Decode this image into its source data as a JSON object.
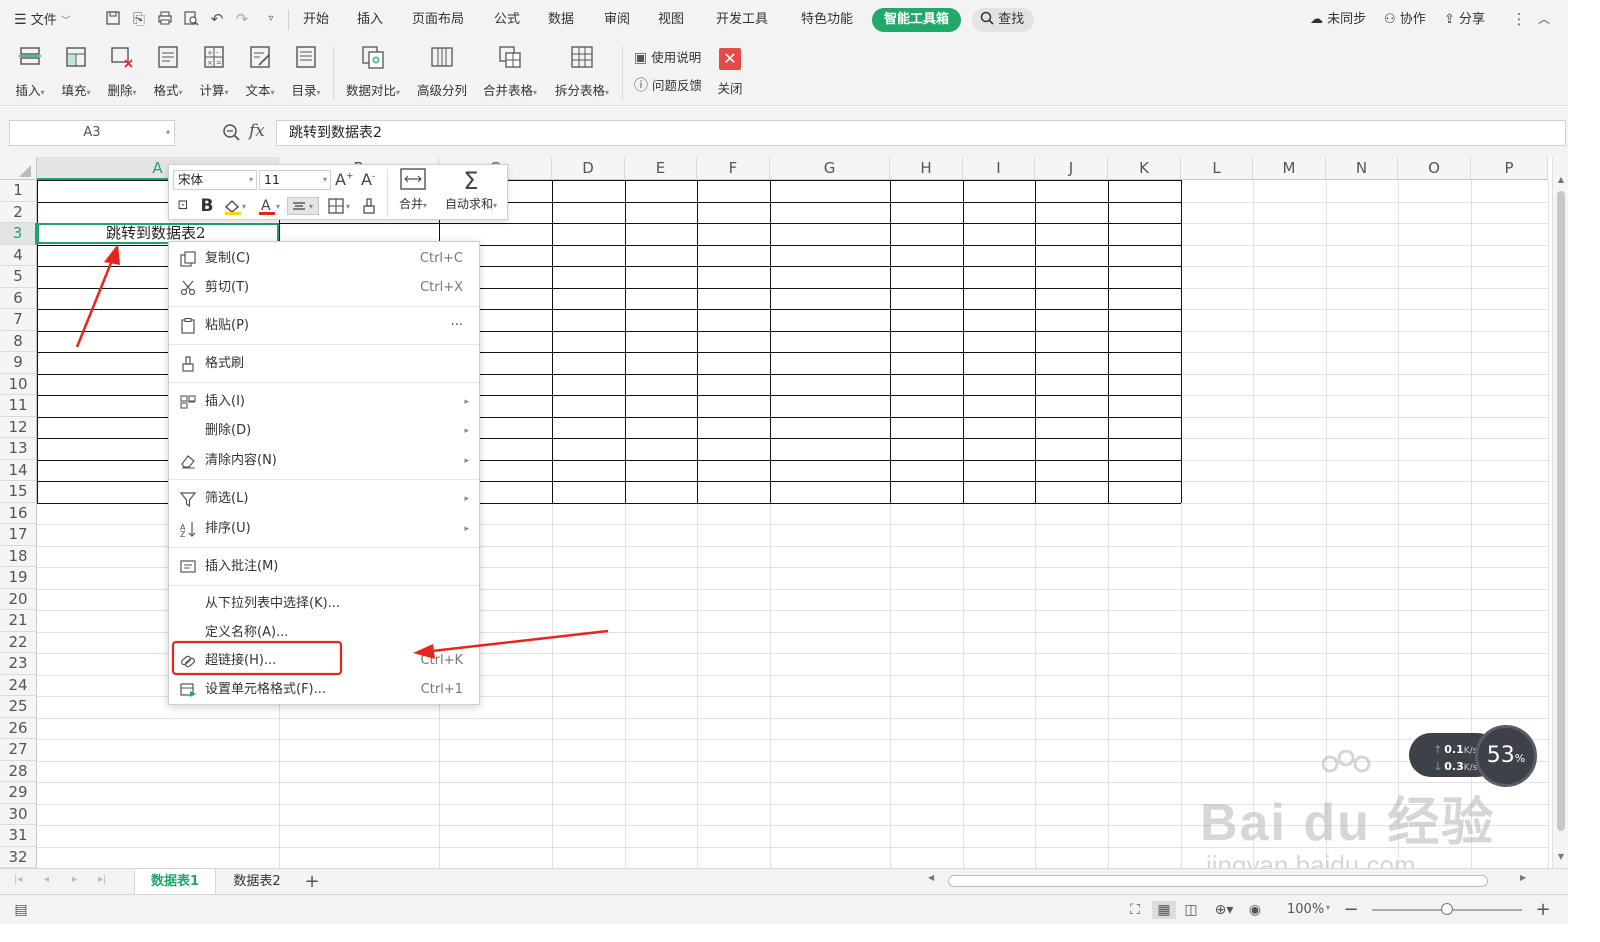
{
  "menubar": {
    "file_label": "文件",
    "tabs": [
      "开始",
      "插入",
      "页面布局",
      "公式",
      "数据",
      "审阅",
      "视图",
      "开发工具",
      "特色功能"
    ],
    "active_tab": "智能工具箱",
    "search_label": "查找",
    "sync_label": "未同步",
    "collab_label": "协作",
    "share_label": "分享"
  },
  "ribbon": {
    "buttons": [
      "插入",
      "填充",
      "删除",
      "格式",
      "计算",
      "文本",
      "目录",
      "数据对比",
      "高级分列",
      "合并表格",
      "拆分表格"
    ],
    "help_label": "使用说明",
    "feedback_label": "问题反馈",
    "close_label": "关闭"
  },
  "formula": {
    "name_box": "A3",
    "fx_label": "fx",
    "content": "跳转到数据表2"
  },
  "grid": {
    "columns": [
      "A",
      "B",
      "C",
      "D",
      "E",
      "F",
      "G",
      "H",
      "I",
      "J",
      "K",
      "L",
      "M",
      "N",
      "O",
      "P"
    ],
    "rows": [
      "1",
      "2",
      "3",
      "4",
      "5",
      "6",
      "7",
      "8",
      "9",
      "10",
      "11",
      "12",
      "13",
      "14",
      "15",
      "16",
      "17",
      "18",
      "19",
      "20",
      "21",
      "22",
      "23",
      "24",
      "25",
      "26",
      "27",
      "28",
      "29",
      "30",
      "31",
      "32"
    ],
    "cell_a3": "跳转到数据表2"
  },
  "minibar": {
    "font": "宋体",
    "size": "11",
    "merge_label": "合并",
    "autosum_label": "自动求和"
  },
  "context_menu": {
    "copy": {
      "label": "复制(C)",
      "shortcut": "Ctrl+C"
    },
    "cut": {
      "label": "剪切(T)",
      "shortcut": "Ctrl+X"
    },
    "paste": {
      "label": "粘贴(P)",
      "more": "···"
    },
    "format_painter": {
      "label": "格式刷"
    },
    "insert": {
      "label": "插入(I)"
    },
    "delete": {
      "label": "删除(D)"
    },
    "clear": {
      "label": "清除内容(N)"
    },
    "filter": {
      "label": "筛选(L)"
    },
    "sort": {
      "label": "排序(U)"
    },
    "comment": {
      "label": "插入批注(M)"
    },
    "pick_list": {
      "label": "从下拉列表中选择(K)..."
    },
    "define_name": {
      "label": "定义名称(A)..."
    },
    "hyperlink": {
      "label": "超链接(H)...",
      "shortcut": "Ctrl+K"
    },
    "format_cells": {
      "label": "设置单元格格式(F)...",
      "shortcut": "Ctrl+1"
    }
  },
  "sheets": {
    "tabs": [
      "数据表1",
      "数据表2"
    ],
    "add": "+"
  },
  "status": {
    "zoom": "100%",
    "zoom_level": 0.5
  },
  "speed_widget": {
    "up": "0.1",
    "down": "0.3",
    "unit": "K/s",
    "percent": "53",
    "percent_sign": "%"
  },
  "watermark": {
    "text": "Bai du 经验",
    "url": "jingyan.baidu.com"
  },
  "colors": {
    "accent_green": "#21a86a",
    "annotation_red": "#e8251c",
    "selection_green": "#21a366"
  }
}
